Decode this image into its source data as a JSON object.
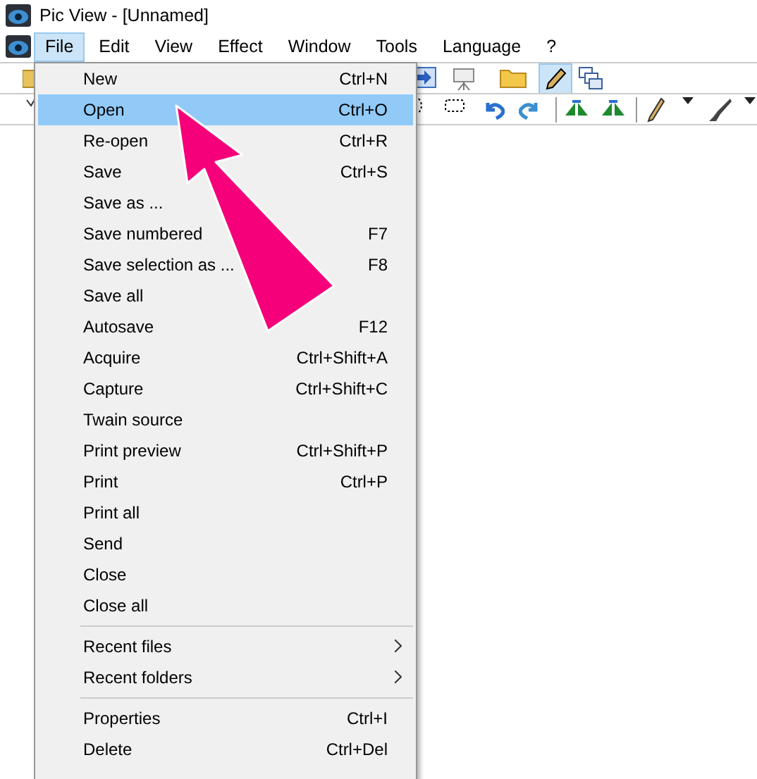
{
  "window": {
    "title": "Pic View - [Unnamed]"
  },
  "menubar": [
    {
      "label": "File",
      "selected": true
    },
    {
      "label": "Edit",
      "selected": false
    },
    {
      "label": "View",
      "selected": false
    },
    {
      "label": "Effect",
      "selected": false
    },
    {
      "label": "Window",
      "selected": false
    },
    {
      "label": "Tools",
      "selected": false
    },
    {
      "label": "Language",
      "selected": false
    },
    {
      "label": "?",
      "selected": false
    }
  ],
  "toolbar_pressed": true,
  "file_menu": {
    "sections": [
      {
        "items": [
          {
            "label": "New",
            "shortcut": "Ctrl+N",
            "selected": false
          },
          {
            "label": "Open",
            "shortcut": "Ctrl+O",
            "selected": true
          },
          {
            "label": "Re-open",
            "shortcut": "Ctrl+R",
            "selected": false
          },
          {
            "label": "Save",
            "shortcut": "Ctrl+S",
            "selected": false
          },
          {
            "label": "Save as ...",
            "selected": false
          },
          {
            "label": "Save numbered",
            "shortcut": "F7",
            "selected": false
          },
          {
            "label": "Save selection as ...",
            "shortcut": "F8",
            "selected": false
          },
          {
            "label": "Save all",
            "selected": false
          },
          {
            "label": "Autosave",
            "shortcut": "F12",
            "selected": false
          },
          {
            "label": "Acquire",
            "shortcut": "Ctrl+Shift+A",
            "selected": false
          },
          {
            "label": "Capture",
            "shortcut": "Ctrl+Shift+C",
            "selected": false
          },
          {
            "label": "Twain source",
            "selected": false
          },
          {
            "label": "Print preview",
            "shortcut": "Ctrl+Shift+P",
            "selected": false
          },
          {
            "label": "Print",
            "shortcut": "Ctrl+P",
            "selected": false
          },
          {
            "label": "Print all",
            "selected": false
          },
          {
            "label": "Send",
            "selected": false
          },
          {
            "label": "Close",
            "selected": false
          },
          {
            "label": "Close all",
            "selected": false
          }
        ]
      },
      {
        "items": [
          {
            "label": "Recent files",
            "submenu": true,
            "selected": false
          },
          {
            "label": "Recent folders",
            "submenu": true,
            "selected": false
          }
        ]
      },
      {
        "items": [
          {
            "label": "Properties",
            "shortcut": "Ctrl+I",
            "selected": false
          },
          {
            "label": "Delete",
            "shortcut": "Ctrl+Del",
            "selected": false
          }
        ]
      }
    ]
  }
}
